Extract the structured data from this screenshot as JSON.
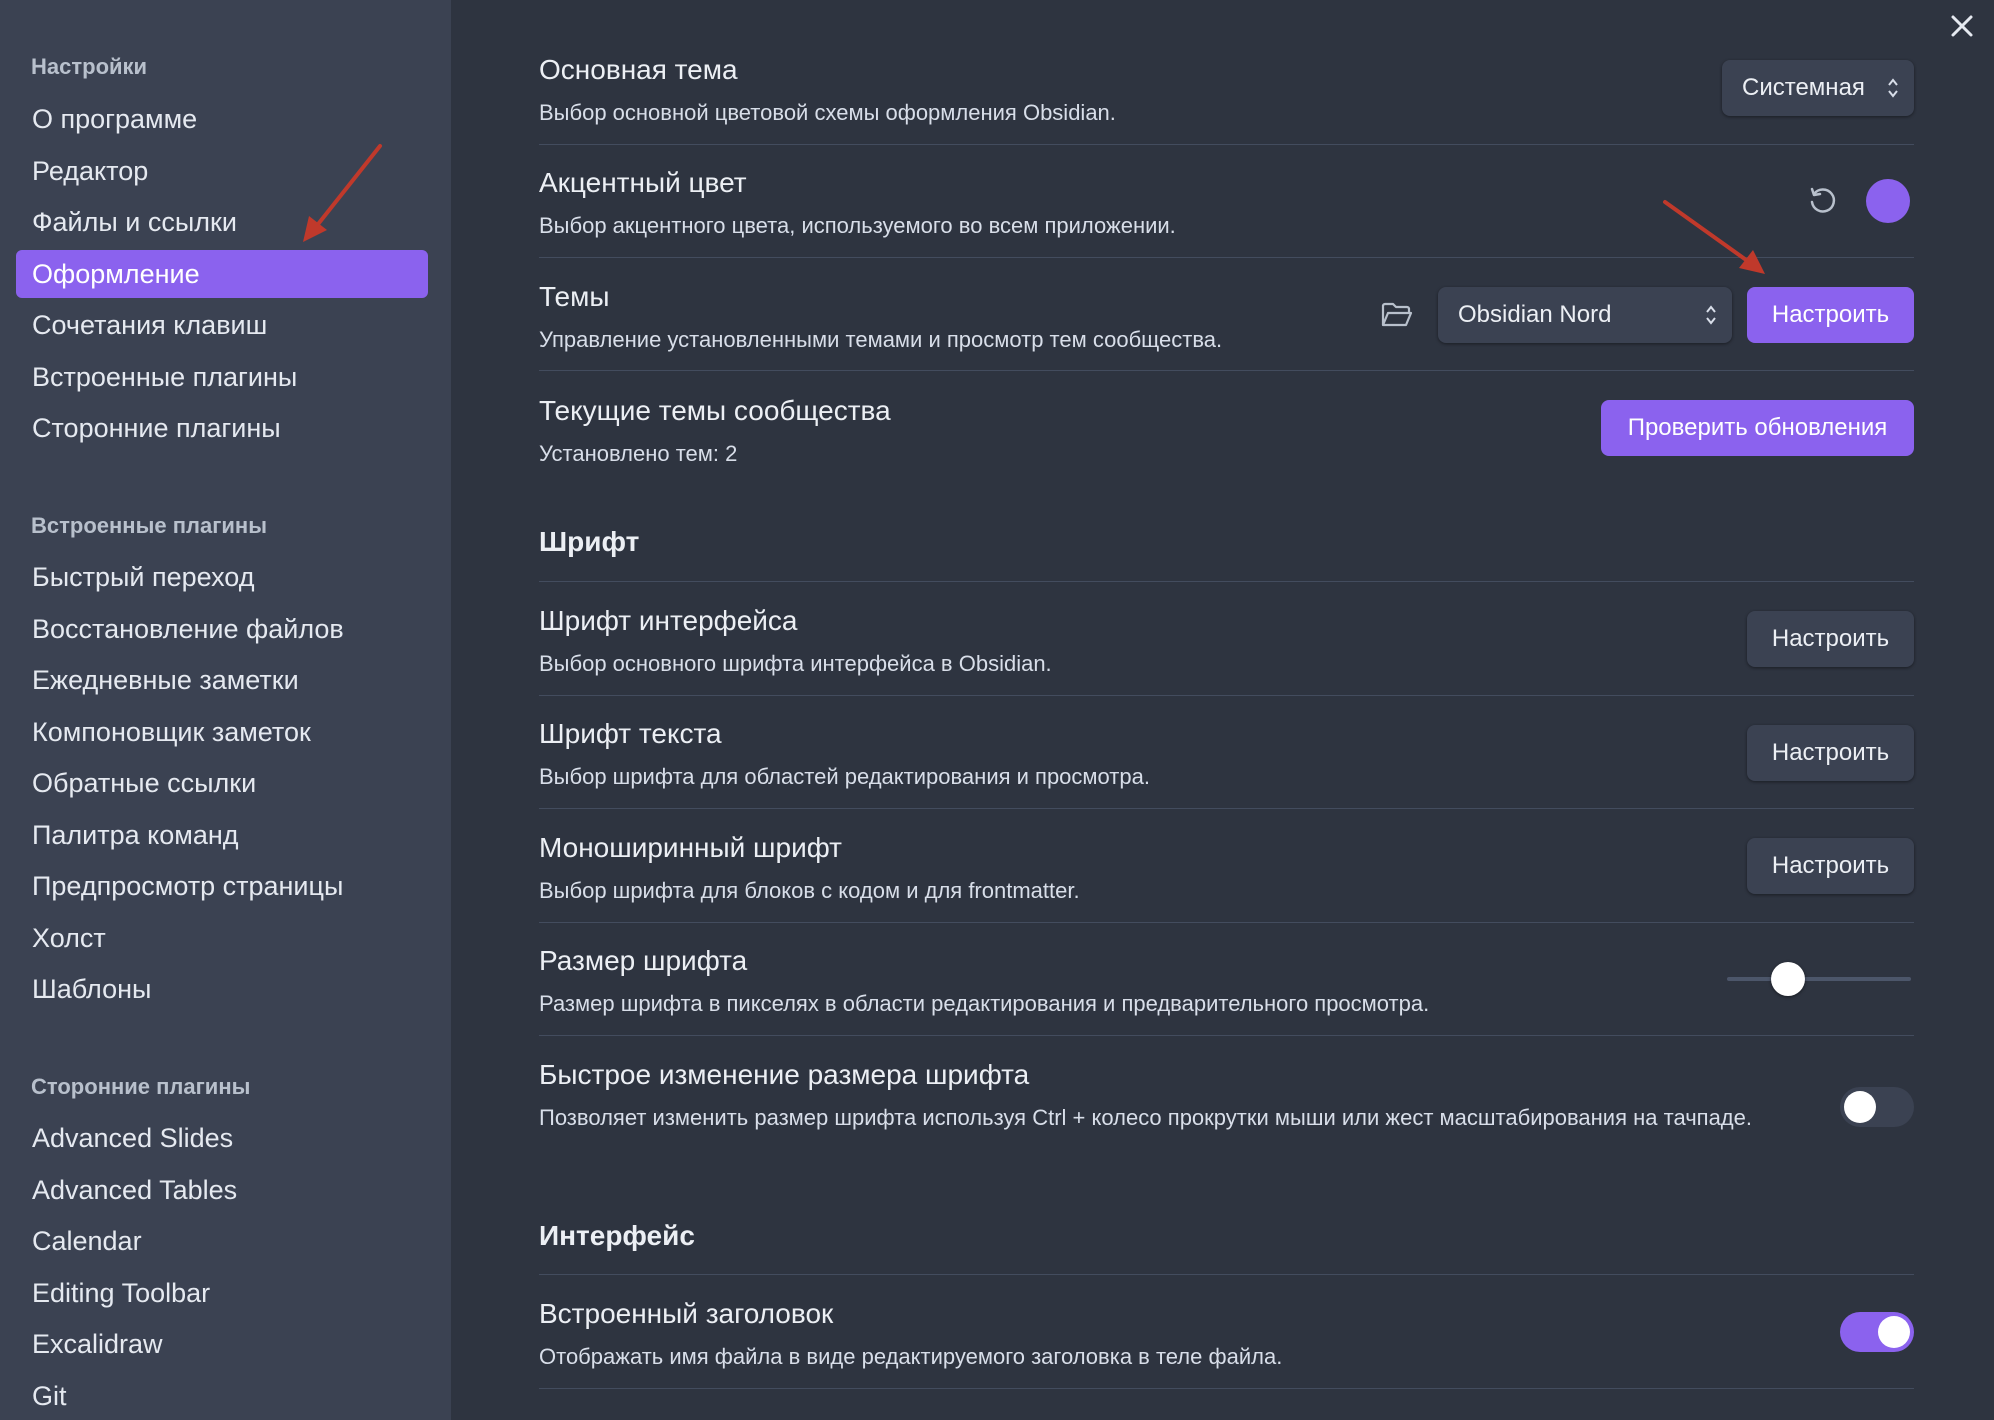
{
  "sidebar": {
    "group_settings": "Настройки",
    "settings_items": [
      {
        "label": "О программе"
      },
      {
        "label": "Редактор"
      },
      {
        "label": "Файлы и ссылки"
      },
      {
        "label": "Оформление",
        "active": true
      },
      {
        "label": "Сочетания клавиш"
      },
      {
        "label": "Встроенные плагины"
      },
      {
        "label": "Сторонние плагины"
      }
    ],
    "group_core_plugins": "Встроенные плагины",
    "core_plugin_items": [
      {
        "label": "Быстрый переход"
      },
      {
        "label": "Восстановление файлов"
      },
      {
        "label": "Ежедневные заметки"
      },
      {
        "label": "Компоновщик заметок"
      },
      {
        "label": "Обратные ссылки"
      },
      {
        "label": "Палитра команд"
      },
      {
        "label": "Предпросмотр страницы"
      },
      {
        "label": "Холст"
      },
      {
        "label": "Шаблоны"
      }
    ],
    "group_community_plugins": "Сторонние плагины",
    "community_plugin_items": [
      {
        "label": "Advanced Slides"
      },
      {
        "label": "Advanced Tables"
      },
      {
        "label": "Calendar"
      },
      {
        "label": "Editing Toolbar"
      },
      {
        "label": "Excalidraw"
      },
      {
        "label": "Git"
      }
    ]
  },
  "main": {
    "base_theme": {
      "title": "Основная тема",
      "desc": "Выбор основной цветовой схемы оформления Obsidian.",
      "value": "Системная"
    },
    "accent_color": {
      "title": "Акцентный цвет",
      "desc": "Выбор акцентного цвета, используемого во всем приложении.",
      "color": "#8b62ee",
      "reset_icon": "rotate-ccw-icon"
    },
    "themes": {
      "title": "Темы",
      "desc": "Управление установленными темами и просмотр тем сообщества.",
      "folder_icon": "folder-open-icon",
      "value": "Obsidian Nord",
      "button": "Настроить"
    },
    "community_themes": {
      "title": "Текущие темы сообщества",
      "desc": "Установлено тем: 2",
      "button": "Проверить обновления"
    },
    "font_section": "Шрифт",
    "interface_font": {
      "title": "Шрифт интерфейса",
      "desc": "Выбор основного шрифта интерфейса в Obsidian.",
      "button": "Настроить"
    },
    "text_font": {
      "title": "Шрифт текста",
      "desc": "Выбор шрифта для областей редактирования и просмотра.",
      "button": "Настроить"
    },
    "mono_font": {
      "title": "Моноширинный шрифт",
      "desc": "Выбор шрифта для блоков с кодом и для frontmatter.",
      "button": "Настроить"
    },
    "font_size": {
      "title": "Размер шрифта",
      "desc": "Размер шрифта в пикселях в области редактирования и предварительного просмотра.",
      "slider_fraction": 0.33
    },
    "quick_font_size": {
      "title": "Быстрое изменение размера шрифта",
      "desc": "Позволяет изменить размер шрифта используя Ctrl + колесо прокрутки мыши или жест масштабирования на тачпаде.",
      "enabled": false
    },
    "interface_section": "Интерфейс",
    "inline_title": {
      "title": "Встроенный заголовок",
      "desc": "Отображать имя файла в виде редактируемого заголовка в теле файла.",
      "enabled": true
    }
  },
  "colors": {
    "accent": "#8b62ee",
    "sidebar_bg": "#3b4252",
    "main_bg": "#2e3440",
    "annotation_arrow": "#c0392b"
  },
  "icons": {
    "close": "close-icon",
    "chevron": "chevron-updown-icon"
  }
}
